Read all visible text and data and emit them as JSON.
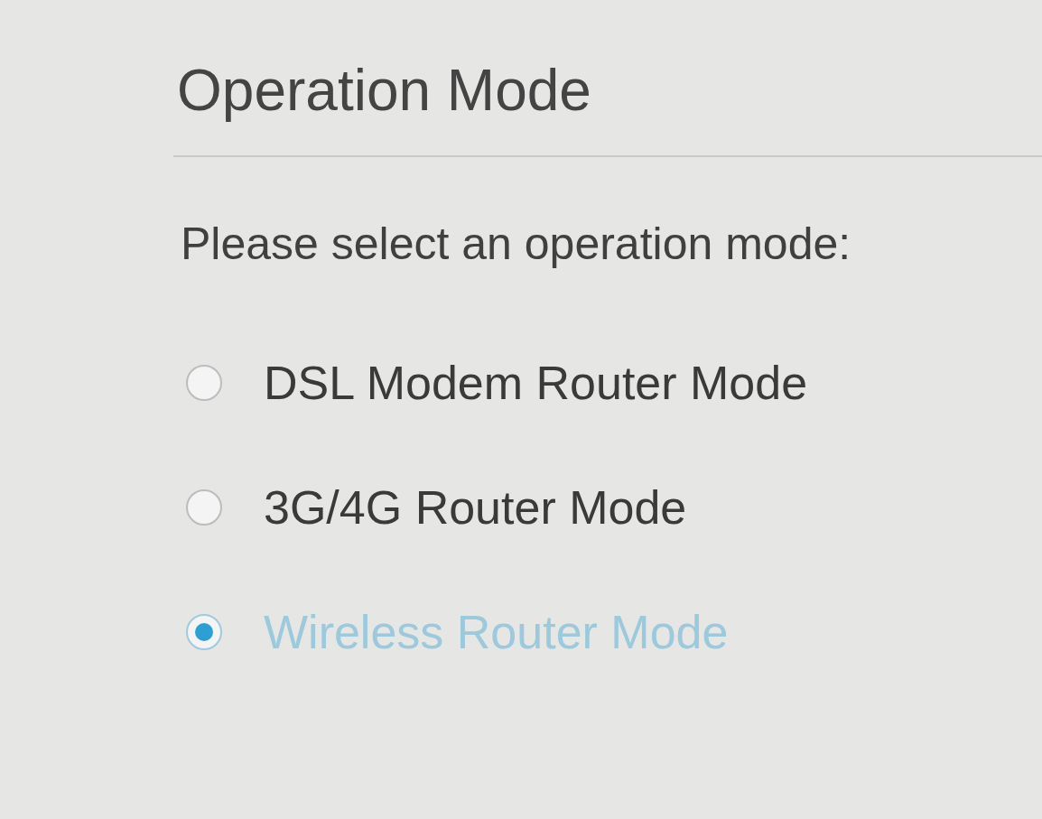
{
  "title": "Operation Mode",
  "prompt": "Please select an operation mode:",
  "options": [
    {
      "label": "DSL Modem Router Mode",
      "selected": false
    },
    {
      "label": "3G/4G Router Mode",
      "selected": false
    },
    {
      "label": "Wireless Router Mode",
      "selected": true
    }
  ]
}
